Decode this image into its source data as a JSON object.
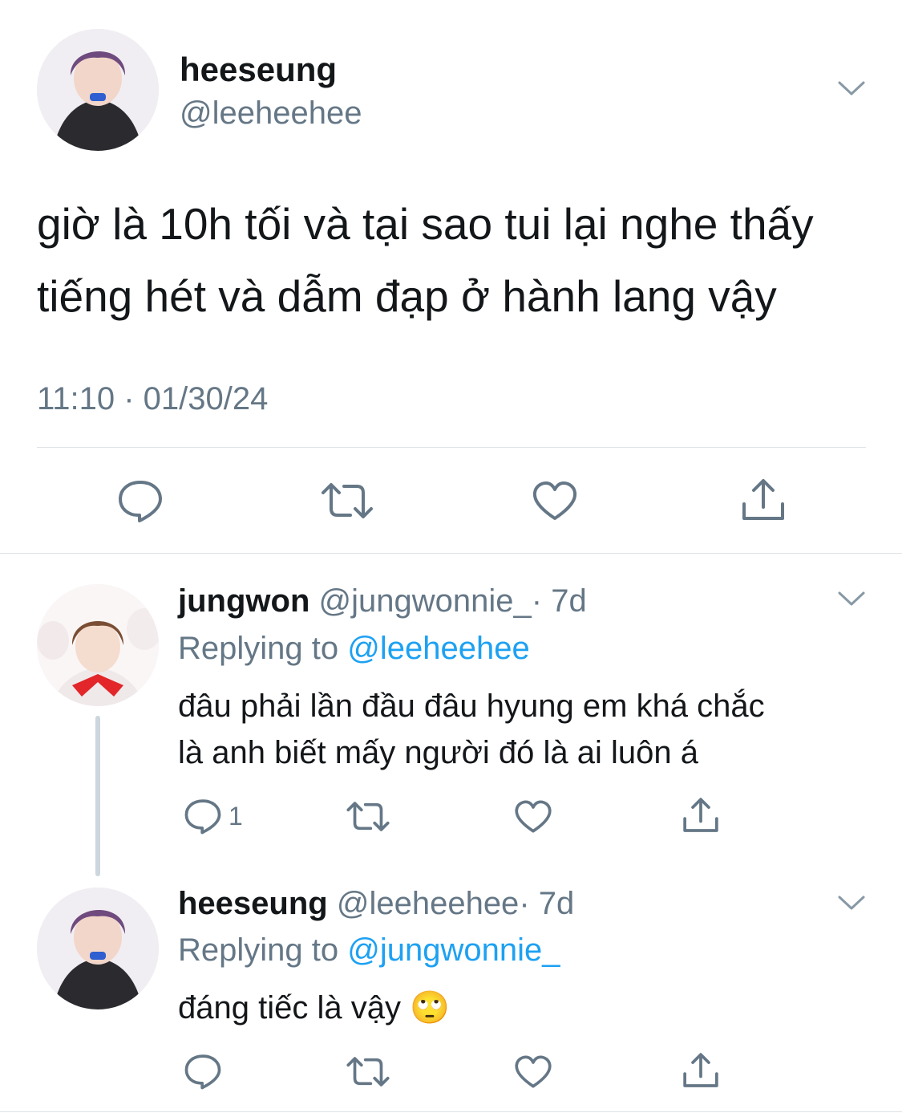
{
  "main_tweet": {
    "display_name": "heeseung",
    "handle": "@leeheehee",
    "text_line1": "giờ là 10h tối và tại sao tui lại nghe thấy",
    "text_line2": "tiếng hét và dẫm đạp ở hành lang vậy",
    "timestamp": "11:10 · 01/30/24",
    "actions": [
      "reply-icon",
      "retweet-icon",
      "like-icon",
      "share-icon"
    ]
  },
  "reply1": {
    "display_name": "jungwon",
    "handle": "@jungwonnie_",
    "age": "· 7d",
    "replying_prefix": "Replying to ",
    "replying_to": "@leeheehee",
    "text_line1": "đâu phải lần đầu đâu hyung em khá chắc",
    "text_line2": "là anh biết mấy người đó là ai luôn á",
    "reply_count": "1"
  },
  "reply2": {
    "display_name": "heeseung",
    "handle": "@leeheehee",
    "age": "· 7d",
    "replying_prefix": "Replying to ",
    "replying_to": "@jungwonnie_",
    "text": "đáng tiếc là vậy",
    "emoji": "🙄"
  },
  "colors": {
    "link": "#1da1f2",
    "muted": "#657786",
    "divider": "#dfe3e7",
    "thread_line": "#ccd6dd"
  }
}
